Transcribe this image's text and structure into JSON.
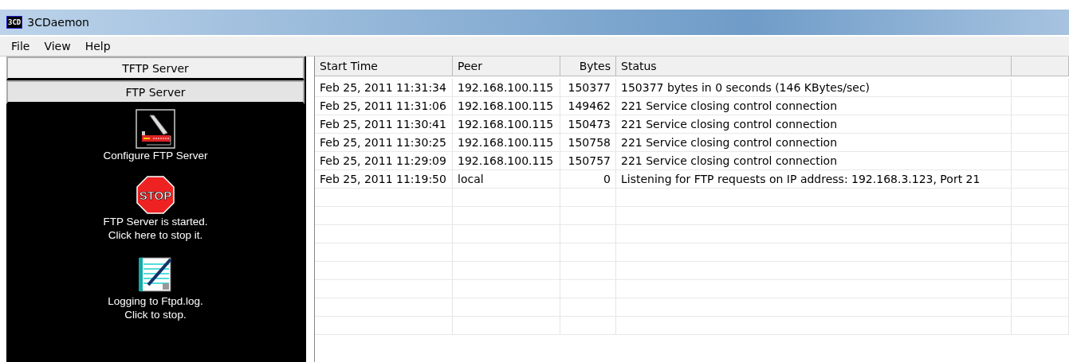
{
  "window": {
    "title": "3CDaemon",
    "app_icon": "3CD"
  },
  "menu": [
    "File",
    "View",
    "Help"
  ],
  "sidebar": {
    "tabs": [
      {
        "label": "TFTP Server",
        "selected": false
      },
      {
        "label": "FTP Server",
        "selected": true
      }
    ],
    "actions": [
      {
        "kind": "configure",
        "lines": [
          "Configure FTP Server"
        ]
      },
      {
        "kind": "stop",
        "icon_text": "STOP",
        "lines": [
          "FTP Server is started.",
          "Click here to stop it."
        ]
      },
      {
        "kind": "log",
        "lines": [
          "Logging to Ftpd.log.",
          "Click to stop."
        ]
      }
    ]
  },
  "table": {
    "columns": [
      "Start Time",
      "Peer",
      "Bytes",
      "Status"
    ],
    "rows": [
      [
        "Feb 25, 2011 11:31:34",
        "192.168.100.115",
        "150377",
        "150377 bytes in 0 seconds (146 KBytes/sec)"
      ],
      [
        "Feb 25, 2011 11:31:06",
        "192.168.100.115",
        "149462",
        "221 Service closing control connection"
      ],
      [
        "Feb 25, 2011 11:30:41",
        "192.168.100.115",
        "150473",
        "221 Service closing control connection"
      ],
      [
        "Feb 25, 2011 11:30:25",
        "192.168.100.115",
        "150758",
        "221 Service closing control connection"
      ],
      [
        "Feb 25, 2011 11:29:09",
        "192.168.100.115",
        "150757",
        "221 Service closing control connection"
      ],
      [
        "Feb 25, 2011 11:19:50",
        "local",
        "0",
        "Listening for FTP requests on IP address: 192.168.3.123, Port 21"
      ]
    ]
  }
}
